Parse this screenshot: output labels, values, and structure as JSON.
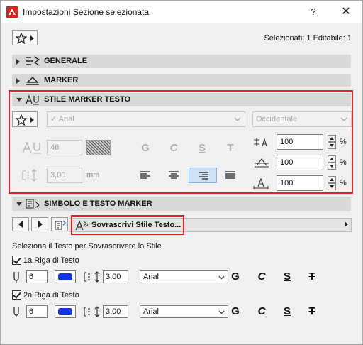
{
  "window": {
    "title": "Impostazioni Sezione selezionata",
    "help": "?",
    "close": "✕"
  },
  "header": {
    "selection_info": "Selezionati: 1 Editabile: 1"
  },
  "sections": {
    "general": "GENERALE",
    "marker": "MARKER",
    "marker_text_style": "STILE MARKER TESTO",
    "symbol_marker_text": "SIMBOLO E TESTO MARKER"
  },
  "text_style": {
    "font": "Arial",
    "script": "Occidentale",
    "size": "46",
    "spacing": "3,00",
    "spacing_unit": "mm",
    "format_buttons": [
      "G",
      "C",
      "S",
      "T"
    ],
    "width_pct": "100",
    "spacing_pct": "100",
    "height_pct": "100",
    "pct_symbol": "%",
    "selected_alignment": "right"
  },
  "override": {
    "button_label": "Sovrascrivi Stile Testo...",
    "instruction": "Seleziona il Testo per Sovrascrivere lo Stile"
  },
  "rows": [
    {
      "label": "1a Riga di Testo",
      "checked": true,
      "pen": "6",
      "spacing": "3,00",
      "font": "Arial"
    },
    {
      "label": "2a Riga di Testo",
      "checked": true,
      "pen": "6",
      "spacing": "3,00",
      "font": "Arial"
    }
  ],
  "colors": {
    "accent_red": "#e31e24",
    "pen_blue": "#1432e6",
    "selection_blue": "#cce0f6"
  }
}
